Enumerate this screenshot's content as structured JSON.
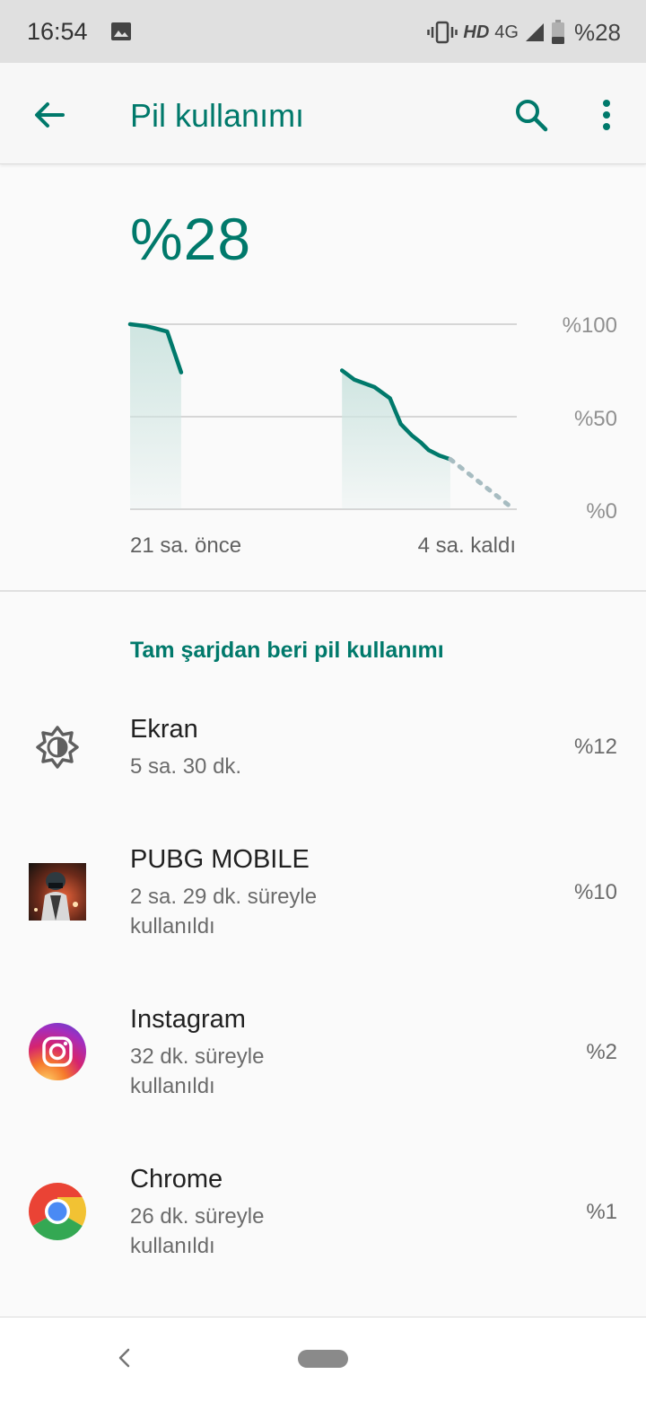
{
  "status_bar": {
    "time": "16:54",
    "hd_label": "HD",
    "network_label": "4G",
    "battery_text": "%28"
  },
  "app_bar": {
    "title": "Pil kullanımı"
  },
  "battery": {
    "percent_text": "%28",
    "level": 28
  },
  "chart_data": {
    "type": "area",
    "ytick_labels": [
      "%100",
      "%50",
      "%0"
    ],
    "ylim": [
      0,
      100
    ],
    "x_start_label": "21 sa. önce",
    "x_end_label": "4 sa. kaldı",
    "x_range_hours": [
      -21,
      4
    ],
    "series": [
      {
        "values": [
          [
            -21,
            100
          ],
          [
            -20,
            99
          ],
          [
            -19.5,
            98
          ],
          [
            -18.6,
            96
          ],
          [
            -17.7,
            74
          ]
        ]
      },
      {
        "values": [
          [
            -7.3,
            75
          ],
          [
            -6.5,
            70
          ],
          [
            -5.2,
            66
          ],
          [
            -4.2,
            60
          ],
          [
            -3.5,
            46
          ],
          [
            -2.8,
            40
          ],
          [
            -2.2,
            36
          ],
          [
            -1.7,
            32
          ],
          [
            -1.0,
            29
          ],
          [
            -0.3,
            27
          ]
        ]
      },
      {
        "projection": true,
        "values": [
          [
            -0.3,
            27
          ],
          [
            3.8,
            0
          ]
        ]
      }
    ],
    "colors": {
      "line": "#00796b",
      "fill": "#cfe5e1",
      "projection": "#a7bcc1",
      "grid": "#d6d6d6"
    },
    "grid": true
  },
  "section_title": "Tam şarjdan beri pil kullanımı",
  "usage": [
    {
      "name": "Ekran",
      "sub": "5 sa. 30 dk.",
      "pct": "%12",
      "icon": "brightness-icon"
    },
    {
      "name": "PUBG MOBILE",
      "sub": "2 sa. 29 dk. süreyle kullanıldı",
      "pct": "%10",
      "icon": "pubg-app-icon"
    },
    {
      "name": "Instagram",
      "sub": "32 dk. süreyle kullanıldı",
      "pct": "%2",
      "icon": "instagram-app-icon"
    },
    {
      "name": "Chrome",
      "sub": "26 dk. süreyle kullanıldı",
      "pct": "%1",
      "icon": "chrome-app-icon"
    }
  ],
  "colors": {
    "accent": "#00796b",
    "status_bar": "#e0e0e0",
    "background": "#fafafa"
  }
}
